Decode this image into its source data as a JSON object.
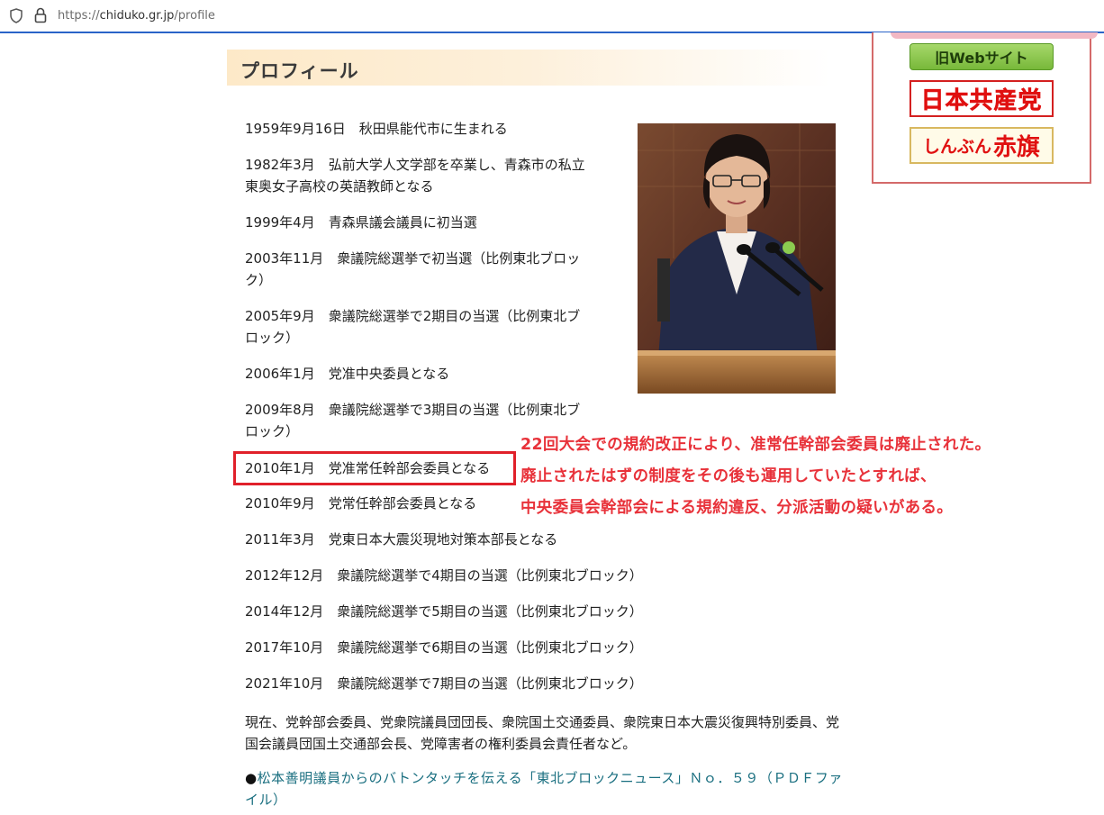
{
  "browser": {
    "url_prefix": "https://",
    "url_host": "chiduko.gr.jp",
    "url_path": "/profile"
  },
  "section": {
    "title": "プロフィール"
  },
  "timeline": [
    "1959年9月16日　秋田県能代市に生まれる",
    "1982年3月　弘前大学人文学部を卒業し、青森市の私立",
    "東奥女子高校の英語教師となる",
    "1999年4月　青森県議会議員に初当選",
    "2003年11月　衆議院総選挙で初当選（比例東北ブロッ",
    "ク）",
    "2005年9月　衆議院総選挙で2期目の当選（比例東北ブ",
    "ロック）",
    "2006年1月　党准中央委員となる",
    "2009年8月　衆議院総選挙で3期目の当選（比例東北ブ",
    "ロック）",
    "2010年1月　党准常任幹部会委員となる",
    "2010年9月　党常任幹部会委員となる",
    "2011年3月　党東日本大震災現地対策本部長となる",
    "2012年12月　衆議院総選挙で4期目の当選（比例東北ブロック）",
    "2014年12月　衆議院総選挙で5期目の当選（比例東北ブロック）",
    "2017年10月　衆議院総選挙で6期目の当選（比例東北ブロック）",
    "2021年10月　衆議院総選挙で7期目の当選（比例東北ブロック）"
  ],
  "current": "現在、党幹部会委員、党衆院議員団団長、衆院国土交通委員、衆院東日本大震災復興特別委員、党国会議員団国土交通部会長、党障害者の権利委員会責任者など。",
  "link": {
    "bullet": "●",
    "text": "松本善明議員からのバトンタッチを伝える「東北ブロックニュース」Ｎｏ．５９（ＰＤＦファイル）"
  },
  "sidebar": {
    "old_web": "旧Webサイト",
    "jcp": "日本共産党",
    "akahata_small": "しんぶん",
    "akahata_large": "赤旗"
  },
  "annotation": [
    "22回大会での規約改正により、准常任幹部会委員は廃止された。",
    "廃止されたはずの制度をその後も運用していたとすれば、",
    "中央委員会幹部会による規約違反、分派活動の疑いがある。"
  ],
  "colors": {
    "annotation": "#e8323a",
    "highlight_border": "#e0202a",
    "link": "#1a6f80"
  }
}
